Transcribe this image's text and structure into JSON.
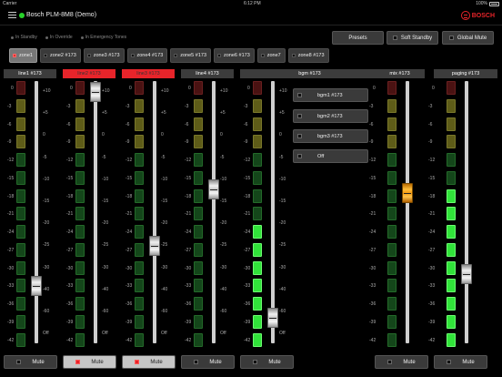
{
  "status_bar": {
    "carrier": "Carrier",
    "time": "6:12 PM",
    "battery": "100%"
  },
  "app": {
    "title": "Bosch PLM-8M8 (Demo)",
    "brand": "BOSCH",
    "connected_color": "#27d42a"
  },
  "legend": [
    "In Standby",
    "In Override",
    "In Emergency Tones"
  ],
  "top_buttons": {
    "presets": "Presets",
    "soft_standby": "Soft Standby",
    "global_mute": "Global Mute"
  },
  "zones": [
    "zone1",
    "zone2 #173",
    "zone3 #173",
    "zone4 #173",
    "zone5 #173",
    "zone6 #173",
    "zone7",
    "zone8 #173"
  ],
  "active_zone": "zone1",
  "meter_scale": [
    "0",
    "-3",
    "-6",
    "-9",
    "-12",
    "-15",
    "-18",
    "-21",
    "-24",
    "-27",
    "-30",
    "-33",
    "-36",
    "-39",
    "-42"
  ],
  "fader_scale": [
    "+10",
    "+5",
    "0",
    "-5",
    "-10",
    "-15",
    "-20",
    "-25",
    "-30",
    "-40",
    "-60",
    "Off"
  ],
  "strips": {
    "line1": {
      "label": "line1 #173",
      "mute": "Mute",
      "muted": false,
      "highlight": false
    },
    "line2": {
      "label": "line2 #173",
      "mute": "Mute",
      "muted": true,
      "highlight": true
    },
    "line3": {
      "label": "line3 #173",
      "mute": "Mute",
      "muted": true,
      "highlight": true
    },
    "line4": {
      "label": "line4 #173",
      "mute": "Mute",
      "muted": false,
      "highlight": false
    },
    "bgm": {
      "label": "bgm #173",
      "mute": "Mute",
      "muted": false,
      "highlight": false,
      "sources": [
        "bgm1 #173",
        "bgm2 #173",
        "bgm3 #173",
        "Off"
      ]
    },
    "mix": {
      "label": "mix #173",
      "mute": "Mute",
      "muted": false,
      "highlight": false
    },
    "paging": {
      "label": "paging #173",
      "mute": "Mute",
      "muted": false,
      "highlight": false
    }
  },
  "colors": {
    "highlight_red": "#e8242a",
    "meter_on": "#31e33a",
    "fader_orange": "#f29a10"
  }
}
